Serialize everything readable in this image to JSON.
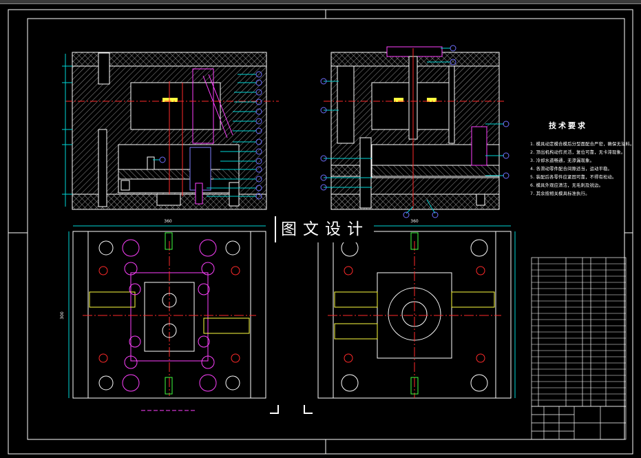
{
  "watermark": {
    "text": "图文设计"
  },
  "technical_notes": {
    "title": "技术要求",
    "lines": [
      "1. 模具动定模合模后分型面配合严密，确保无溢料。",
      "2. 顶出机构动作灵活，复位可靠，无卡滞现象。",
      "3. 冷却水道畅通，无渗漏现象。",
      "4. 各滑动零件配合间隙适当，运动平稳。",
      "5. 装配后各零件应紧固可靠，不得有松动。",
      "6. 模具外观应清洁，无毛刺及锐边。",
      "7. 其余按相关模具标准执行。"
    ]
  },
  "dimensions": {
    "plan_left_width": "360",
    "plan_right_width": "360",
    "plan_height": "300"
  },
  "colors": {
    "background": "#000000",
    "outline": "#ffffff",
    "center_line": "#ff2a2a",
    "dimension": "#00d7d7",
    "balloon": "#7070ff",
    "magenta": "#ff40ff",
    "green": "#40ff40",
    "yellow": "#ffff40",
    "hatch": "#c8c8c8"
  }
}
